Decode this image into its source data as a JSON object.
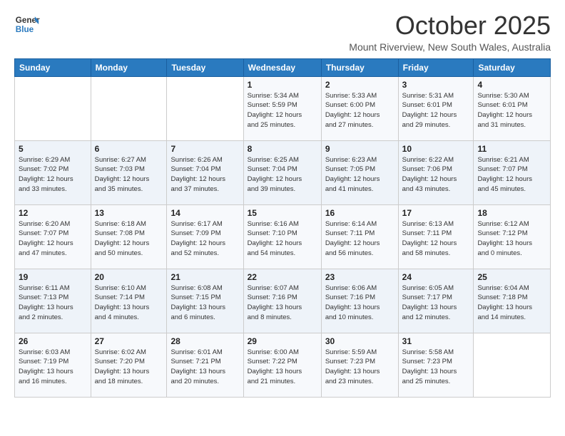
{
  "header": {
    "logo_line1": "General",
    "logo_line2": "Blue",
    "month": "October 2025",
    "location": "Mount Riverview, New South Wales, Australia"
  },
  "weekdays": [
    "Sunday",
    "Monday",
    "Tuesday",
    "Wednesday",
    "Thursday",
    "Friday",
    "Saturday"
  ],
  "weeks": [
    [
      {
        "day": "",
        "info": ""
      },
      {
        "day": "",
        "info": ""
      },
      {
        "day": "",
        "info": ""
      },
      {
        "day": "1",
        "info": "Sunrise: 5:34 AM\nSunset: 5:59 PM\nDaylight: 12 hours\nand 25 minutes."
      },
      {
        "day": "2",
        "info": "Sunrise: 5:33 AM\nSunset: 6:00 PM\nDaylight: 12 hours\nand 27 minutes."
      },
      {
        "day": "3",
        "info": "Sunrise: 5:31 AM\nSunset: 6:01 PM\nDaylight: 12 hours\nand 29 minutes."
      },
      {
        "day": "4",
        "info": "Sunrise: 5:30 AM\nSunset: 6:01 PM\nDaylight: 12 hours\nand 31 minutes."
      }
    ],
    [
      {
        "day": "5",
        "info": "Sunrise: 6:29 AM\nSunset: 7:02 PM\nDaylight: 12 hours\nand 33 minutes."
      },
      {
        "day": "6",
        "info": "Sunrise: 6:27 AM\nSunset: 7:03 PM\nDaylight: 12 hours\nand 35 minutes."
      },
      {
        "day": "7",
        "info": "Sunrise: 6:26 AM\nSunset: 7:04 PM\nDaylight: 12 hours\nand 37 minutes."
      },
      {
        "day": "8",
        "info": "Sunrise: 6:25 AM\nSunset: 7:04 PM\nDaylight: 12 hours\nand 39 minutes."
      },
      {
        "day": "9",
        "info": "Sunrise: 6:23 AM\nSunset: 7:05 PM\nDaylight: 12 hours\nand 41 minutes."
      },
      {
        "day": "10",
        "info": "Sunrise: 6:22 AM\nSunset: 7:06 PM\nDaylight: 12 hours\nand 43 minutes."
      },
      {
        "day": "11",
        "info": "Sunrise: 6:21 AM\nSunset: 7:07 PM\nDaylight: 12 hours\nand 45 minutes."
      }
    ],
    [
      {
        "day": "12",
        "info": "Sunrise: 6:20 AM\nSunset: 7:07 PM\nDaylight: 12 hours\nand 47 minutes."
      },
      {
        "day": "13",
        "info": "Sunrise: 6:18 AM\nSunset: 7:08 PM\nDaylight: 12 hours\nand 50 minutes."
      },
      {
        "day": "14",
        "info": "Sunrise: 6:17 AM\nSunset: 7:09 PM\nDaylight: 12 hours\nand 52 minutes."
      },
      {
        "day": "15",
        "info": "Sunrise: 6:16 AM\nSunset: 7:10 PM\nDaylight: 12 hours\nand 54 minutes."
      },
      {
        "day": "16",
        "info": "Sunrise: 6:14 AM\nSunset: 7:11 PM\nDaylight: 12 hours\nand 56 minutes."
      },
      {
        "day": "17",
        "info": "Sunrise: 6:13 AM\nSunset: 7:11 PM\nDaylight: 12 hours\nand 58 minutes."
      },
      {
        "day": "18",
        "info": "Sunrise: 6:12 AM\nSunset: 7:12 PM\nDaylight: 13 hours\nand 0 minutes."
      }
    ],
    [
      {
        "day": "19",
        "info": "Sunrise: 6:11 AM\nSunset: 7:13 PM\nDaylight: 13 hours\nand 2 minutes."
      },
      {
        "day": "20",
        "info": "Sunrise: 6:10 AM\nSunset: 7:14 PM\nDaylight: 13 hours\nand 4 minutes."
      },
      {
        "day": "21",
        "info": "Sunrise: 6:08 AM\nSunset: 7:15 PM\nDaylight: 13 hours\nand 6 minutes."
      },
      {
        "day": "22",
        "info": "Sunrise: 6:07 AM\nSunset: 7:16 PM\nDaylight: 13 hours\nand 8 minutes."
      },
      {
        "day": "23",
        "info": "Sunrise: 6:06 AM\nSunset: 7:16 PM\nDaylight: 13 hours\nand 10 minutes."
      },
      {
        "day": "24",
        "info": "Sunrise: 6:05 AM\nSunset: 7:17 PM\nDaylight: 13 hours\nand 12 minutes."
      },
      {
        "day": "25",
        "info": "Sunrise: 6:04 AM\nSunset: 7:18 PM\nDaylight: 13 hours\nand 14 minutes."
      }
    ],
    [
      {
        "day": "26",
        "info": "Sunrise: 6:03 AM\nSunset: 7:19 PM\nDaylight: 13 hours\nand 16 minutes."
      },
      {
        "day": "27",
        "info": "Sunrise: 6:02 AM\nSunset: 7:20 PM\nDaylight: 13 hours\nand 18 minutes."
      },
      {
        "day": "28",
        "info": "Sunrise: 6:01 AM\nSunset: 7:21 PM\nDaylight: 13 hours\nand 20 minutes."
      },
      {
        "day": "29",
        "info": "Sunrise: 6:00 AM\nSunset: 7:22 PM\nDaylight: 13 hours\nand 21 minutes."
      },
      {
        "day": "30",
        "info": "Sunrise: 5:59 AM\nSunset: 7:23 PM\nDaylight: 13 hours\nand 23 minutes."
      },
      {
        "day": "31",
        "info": "Sunrise: 5:58 AM\nSunset: 7:23 PM\nDaylight: 13 hours\nand 25 minutes."
      },
      {
        "day": "",
        "info": ""
      }
    ]
  ]
}
